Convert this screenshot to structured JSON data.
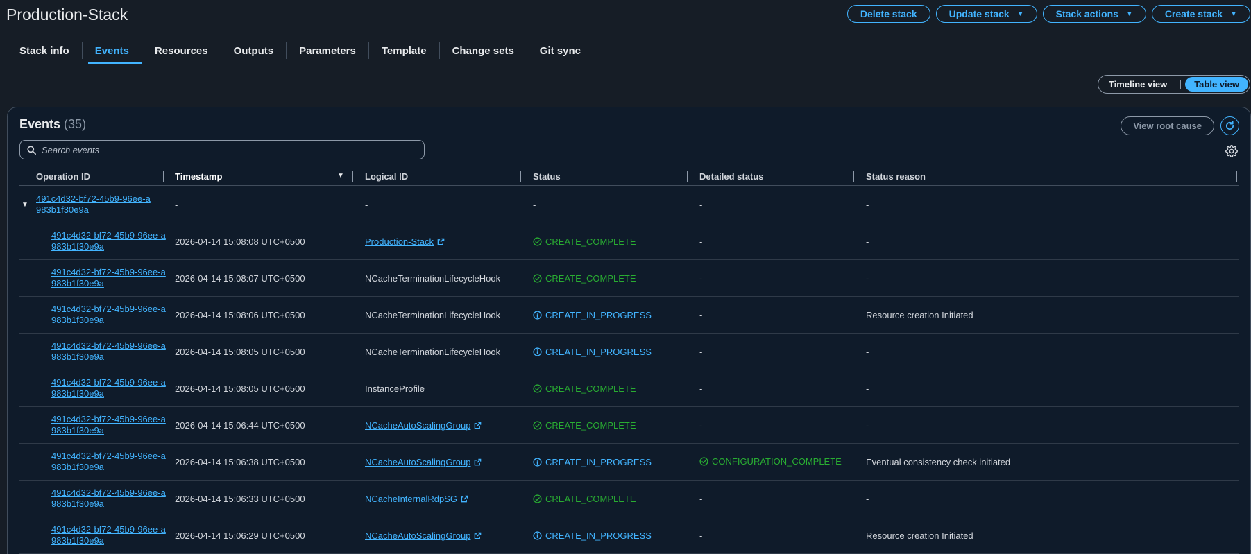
{
  "page": {
    "title": "Production-Stack"
  },
  "actions": [
    {
      "label": "Delete stack",
      "dropdown": false
    },
    {
      "label": "Update stack",
      "dropdown": true
    },
    {
      "label": "Stack actions",
      "dropdown": true
    },
    {
      "label": "Create stack",
      "dropdown": true
    }
  ],
  "tabs": [
    {
      "label": "Stack info",
      "active": false
    },
    {
      "label": "Events",
      "active": true
    },
    {
      "label": "Resources",
      "active": false
    },
    {
      "label": "Outputs",
      "active": false
    },
    {
      "label": "Parameters",
      "active": false
    },
    {
      "label": "Template",
      "active": false
    },
    {
      "label": "Change sets",
      "active": false
    },
    {
      "label": "Git sync",
      "active": false
    }
  ],
  "view_toggle": {
    "timeline_label": "Timeline view",
    "table_label": "Table view",
    "selected": "Table view"
  },
  "events": {
    "title": "Events",
    "count": "(35)",
    "root_cause_label": "View root cause",
    "search_placeholder": "Search events",
    "columns": [
      "Operation ID",
      "Timestamp",
      "Logical ID",
      "Status",
      "Detailed status",
      "Status reason"
    ],
    "sort": {
      "column": "Timestamp",
      "direction": "descending"
    },
    "rows": [
      {
        "group": true,
        "operation_id": "491c4d32-bf72-45b9-96ee-a983b1f30e9a",
        "timestamp": "-",
        "logical_id": "-",
        "logical_link": false,
        "status": "-",
        "status_kind": "none",
        "detailed_status": "-",
        "detailed_kind": "none",
        "reason": "-"
      },
      {
        "group": false,
        "operation_id": "491c4d32-bf72-45b9-96ee-a983b1f30e9a",
        "timestamp": "2026-04-14 15:08:08 UTC+0500",
        "logical_id": "Production-Stack",
        "logical_link": true,
        "status": "CREATE_COMPLETE",
        "status_kind": "ok",
        "detailed_status": "-",
        "detailed_kind": "none",
        "reason": "-"
      },
      {
        "group": false,
        "operation_id": "491c4d32-bf72-45b9-96ee-a983b1f30e9a",
        "timestamp": "2026-04-14 15:08:07 UTC+0500",
        "logical_id": "NCacheTerminationLifecycleHook",
        "logical_link": false,
        "status": "CREATE_COMPLETE",
        "status_kind": "ok",
        "detailed_status": "-",
        "detailed_kind": "none",
        "reason": "-"
      },
      {
        "group": false,
        "operation_id": "491c4d32-bf72-45b9-96ee-a983b1f30e9a",
        "timestamp": "2026-04-14 15:08:06 UTC+0500",
        "logical_id": "NCacheTerminationLifecycleHook",
        "logical_link": false,
        "status": "CREATE_IN_PROGRESS",
        "status_kind": "prog",
        "detailed_status": "-",
        "detailed_kind": "none",
        "reason": "Resource creation Initiated"
      },
      {
        "group": false,
        "operation_id": "491c4d32-bf72-45b9-96ee-a983b1f30e9a",
        "timestamp": "2026-04-14 15:08:05 UTC+0500",
        "logical_id": "NCacheTerminationLifecycleHook",
        "logical_link": false,
        "status": "CREATE_IN_PROGRESS",
        "status_kind": "prog",
        "detailed_status": "-",
        "detailed_kind": "none",
        "reason": "-"
      },
      {
        "group": false,
        "operation_id": "491c4d32-bf72-45b9-96ee-a983b1f30e9a",
        "timestamp": "2026-04-14 15:08:05 UTC+0500",
        "logical_id": "InstanceProfile",
        "logical_link": false,
        "status": "CREATE_COMPLETE",
        "status_kind": "ok",
        "detailed_status": "-",
        "detailed_kind": "none",
        "reason": "-"
      },
      {
        "group": false,
        "operation_id": "491c4d32-bf72-45b9-96ee-a983b1f30e9a",
        "timestamp": "2026-04-14 15:06:44 UTC+0500",
        "logical_id": "NCacheAutoScalingGroup",
        "logical_link": true,
        "status": "CREATE_COMPLETE",
        "status_kind": "ok",
        "detailed_status": "-",
        "detailed_kind": "none",
        "reason": "-"
      },
      {
        "group": false,
        "operation_id": "491c4d32-bf72-45b9-96ee-a983b1f30e9a",
        "timestamp": "2026-04-14 15:06:38 UTC+0500",
        "logical_id": "NCacheAutoScalingGroup",
        "logical_link": true,
        "status": "CREATE_IN_PROGRESS",
        "status_kind": "prog",
        "detailed_status": "CONFIGURATION_COMPLETE",
        "detailed_kind": "ok",
        "reason": "Eventual consistency check initiated"
      },
      {
        "group": false,
        "operation_id": "491c4d32-bf72-45b9-96ee-a983b1f30e9a",
        "timestamp": "2026-04-14 15:06:33 UTC+0500",
        "logical_id": "NCacheInternalRdpSG",
        "logical_link": true,
        "status": "CREATE_COMPLETE",
        "status_kind": "ok",
        "detailed_status": "-",
        "detailed_kind": "none",
        "reason": "-"
      },
      {
        "group": false,
        "operation_id": "491c4d32-bf72-45b9-96ee-a983b1f30e9a",
        "timestamp": "2026-04-14 15:06:29 UTC+0500",
        "logical_id": "NCacheAutoScalingGroup",
        "logical_link": true,
        "status": "CREATE_IN_PROGRESS",
        "status_kind": "prog",
        "detailed_status": "-",
        "detailed_kind": "none",
        "reason": "Resource creation Initiated"
      }
    ]
  },
  "colors": {
    "accent": "#42b4ff",
    "success": "#29ad32",
    "background": "#161d26",
    "panel": "#0f1b2a"
  }
}
